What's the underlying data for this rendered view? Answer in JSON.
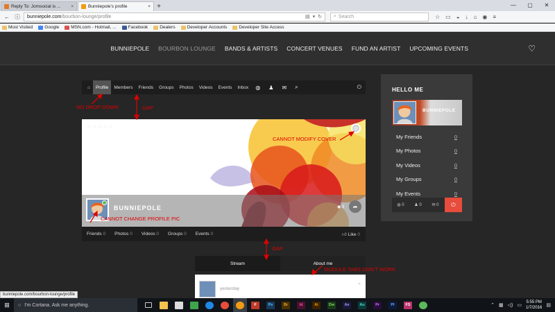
{
  "browser": {
    "tabs": [
      {
        "title": "Reply To: Jomsocial is ..."
      },
      {
        "title": "Bunniepole's profile"
      }
    ],
    "url_host": "bunniepole.com",
    "url_path": "/bourbon-lounge/profile",
    "search_placeholder": "Search",
    "bookmarks": [
      "Most Visited",
      "Google",
      "MSN.com - Hotmail, ...",
      "Facebook",
      "Dealers",
      "Developer Accounts",
      "Developer Site Access"
    ]
  },
  "site": {
    "nav": [
      "BUNNIEPOLE",
      "BOURBON LOUNGE",
      "BANDS & ARTISTS",
      "CONCERT VENUES",
      "FUND AN ARTIST",
      "UPCOMING EVENTS"
    ],
    "nav_active_index": 1
  },
  "profile": {
    "toolbar": [
      "Profile",
      "Members",
      "Friends",
      "Groups",
      "Photos",
      "Videos",
      "Events",
      "Inbox"
    ],
    "name": "BUNNIEPOLE",
    "views": "3",
    "stats": [
      {
        "label": "Friends",
        "count": "0"
      },
      {
        "label": "Photos",
        "count": "0"
      },
      {
        "label": "Videos",
        "count": "0"
      },
      {
        "label": "Groups",
        "count": "0"
      },
      {
        "label": "Events",
        "count": "0"
      }
    ],
    "like_label": "Like",
    "like_count": "0",
    "module_tabs": [
      "Stream",
      "About me"
    ],
    "stream_time": "yesterday"
  },
  "sidebar": {
    "title": "HELLO ME",
    "name": "BUNNIEPOLE",
    "items": [
      {
        "label": "My Friends",
        "count": "0"
      },
      {
        "label": "My Photos",
        "count": "0"
      },
      {
        "label": "My Videos",
        "count": "0"
      },
      {
        "label": "My Groups",
        "count": "0"
      },
      {
        "label": "My Events",
        "count": "0"
      }
    ],
    "footer_counts": [
      "0",
      "0",
      "0"
    ]
  },
  "annotations": {
    "no_drop_down": "NO DROP DOWN",
    "gap1": "GAP",
    "cannot_modify_cover": "CANNOT MODIFY COVER",
    "cannot_change_pic": "CANNOT CHANGE PROFILE PIC",
    "gap2": "GAP",
    "module_tabs": "MODULE TABS DON'T WORK"
  },
  "status_link": "bunniepole.com/bourbon-lounge/profile",
  "taskbar": {
    "cortana": "I'm Cortana. Ask me anything.",
    "time": "5:55 PM",
    "date": "1/7/2016"
  },
  "colors": {
    "accent_red": "#e74c3c",
    "annotation": "#e00000",
    "online": "#5cb85c"
  }
}
